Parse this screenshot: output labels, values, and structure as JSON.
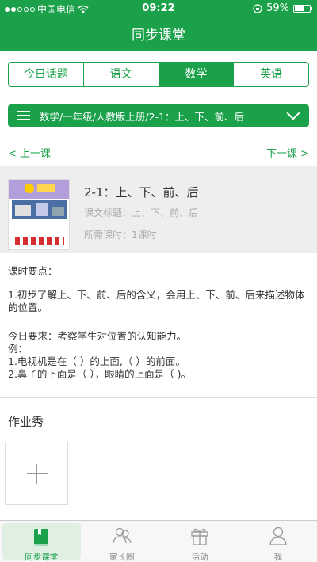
{
  "status_bar": {
    "carrier": "中国电信",
    "time": "09:22",
    "battery": "59%",
    "battery_level": 0.59,
    "icons": [
      "signal-dots-icon",
      "wifi-icon",
      "orientation-lock-icon",
      "battery-icon"
    ]
  },
  "header": {
    "title": "同步课堂"
  },
  "subject_tabs": [
    {
      "label": "今日话题",
      "active": false
    },
    {
      "label": "语文",
      "active": false
    },
    {
      "label": "数学",
      "active": true
    },
    {
      "label": "英语",
      "active": false
    }
  ],
  "breadcrumb": {
    "text": "数学/一年级/人教版上册/2-1：上、下、前、后"
  },
  "nav": {
    "prev": "< 上一课",
    "next": "下一课 >"
  },
  "lesson": {
    "title": "2-1：上、下、前、后",
    "subtitle": "课文标题：上、下、前、后",
    "hours": "所需课时：1课时"
  },
  "key_points": {
    "heading": "课时要点：",
    "goal": "1.初步了解上、下、前、后的含义，会用上、下、前、后来描述物体的位置。",
    "requirement": "今日要求：考察学生对位置的认知能力。",
    "example_label": "例：",
    "example_1": "1.电视机是在（  ）的上面,（  ）的前面。",
    "example_2": "2.鼻子的下面是（   ），眼睛的上面是（  )。"
  },
  "homework": {
    "title": "作业秀"
  },
  "tabbar": [
    {
      "label": "同步课堂",
      "icon": "book-icon",
      "active": true
    },
    {
      "label": "家长圈",
      "icon": "parents-icon",
      "active": false
    },
    {
      "label": "活动",
      "icon": "gift-icon",
      "active": false
    },
    {
      "label": "我",
      "icon": "person-icon",
      "active": false
    }
  ],
  "colors": {
    "brand": "#1ba14a",
    "lesson_bg": "#eeeeee",
    "muted": "#aaaaaa"
  }
}
